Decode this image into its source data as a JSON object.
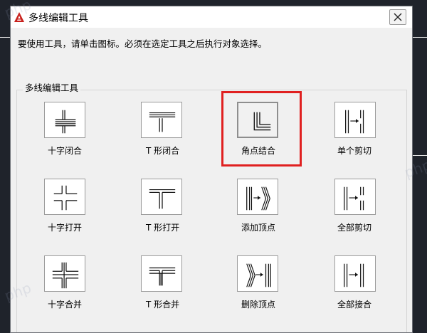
{
  "dialog": {
    "title": "多线编辑工具",
    "instruction": "要使用工具，请单击图标。必须在选定工具之后执行对象选择。",
    "group_label": "多线编辑工具",
    "accent_color": "#e02020"
  },
  "tools": [
    {
      "id": "cross-closed",
      "label": "十字闭合",
      "icon": "cross-closed-icon",
      "selected": false
    },
    {
      "id": "tee-closed",
      "label": "T 形闭合",
      "icon": "tee-closed-icon",
      "selected": false
    },
    {
      "id": "corner-joint",
      "label": "角点结合",
      "icon": "corner-joint-icon",
      "selected": true
    },
    {
      "id": "cut-single",
      "label": "单个剪切",
      "icon": "cut-single-icon",
      "selected": false
    },
    {
      "id": "cross-open",
      "label": "十字打开",
      "icon": "cross-open-icon",
      "selected": false
    },
    {
      "id": "tee-open",
      "label": "T 形打开",
      "icon": "tee-open-icon",
      "selected": false
    },
    {
      "id": "add-vertex",
      "label": "添加顶点",
      "icon": "add-vertex-icon",
      "selected": false
    },
    {
      "id": "cut-all",
      "label": "全部剪切",
      "icon": "cut-all-icon",
      "selected": false
    },
    {
      "id": "cross-merged",
      "label": "十字合并",
      "icon": "cross-merged-icon",
      "selected": false
    },
    {
      "id": "tee-merged",
      "label": "T 形合并",
      "icon": "tee-merged-icon",
      "selected": false
    },
    {
      "id": "delete-vertex",
      "label": "删除顶点",
      "icon": "delete-vertex-icon",
      "selected": false
    },
    {
      "id": "weld-all",
      "label": "全部接合",
      "icon": "weld-all-icon",
      "selected": false
    }
  ],
  "watermark": "php"
}
